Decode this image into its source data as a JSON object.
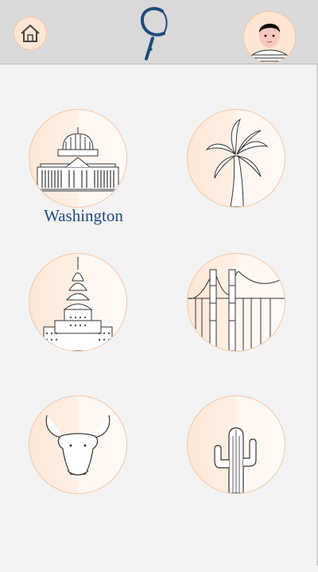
{
  "header": {
    "home_icon": "home-icon",
    "logo_icon": "magnifier-logo-icon",
    "avatar_icon": "user-avatar"
  },
  "cities": [
    {
      "label": "Washington",
      "icon": "capitol-building-icon"
    },
    {
      "label": "",
      "icon": "palm-tree-icon"
    },
    {
      "label": "",
      "icon": "chrysler-building-icon"
    },
    {
      "label": "",
      "icon": "golden-gate-bridge-icon"
    },
    {
      "label": "",
      "icon": "bull-head-icon"
    },
    {
      "label": "",
      "icon": "cactus-icon"
    }
  ],
  "colors": {
    "accent_peach": "#fde6d3",
    "border_peach": "#f4c8a6",
    "label_blue": "#1e4a7a",
    "header_gray": "#d9d9d9"
  }
}
